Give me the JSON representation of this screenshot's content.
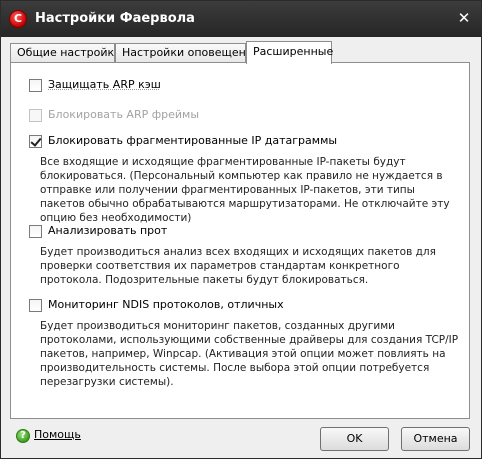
{
  "window": {
    "title": "Настройки Фаервола",
    "app_icon_letter": "C"
  },
  "tabs": [
    {
      "label": "Общие настройки"
    },
    {
      "label": "Настройки оповещений"
    },
    {
      "label": "Расширенные"
    }
  ],
  "options": [
    {
      "label": "Защищать ARP кэш",
      "checked": false,
      "enabled": true,
      "description": ""
    },
    {
      "label": "Блокировать ARP фреймы",
      "checked": false,
      "enabled": false,
      "description": ""
    },
    {
      "label": "Блокировать фрагментированные IP датаграммы",
      "checked": true,
      "enabled": true,
      "description": "Все входящие и исходящие фрагментированные IP-пакеты будут блокироваться. (Персональный компьютер как правило не нуждается в отправке или получении фрагментированных IP-пакетов, эти типы пакетов обычно обрабатываются маршрутизаторами. Не отключайте эту опцию без необходимости)"
    },
    {
      "label": "Анализировать прот",
      "checked": false,
      "enabled": true,
      "description": "Будет производиться анализ всех входящих и исходящих пакетов для проверки соответствия их параметров стандартам конкретного протокола. Подозрительные пакеты будут блокироваться."
    },
    {
      "label": "Мониторинг NDIS протоколов, отличных",
      "checked": false,
      "enabled": true,
      "description": "Будет производиться мониторинг пакетов, созданных другими протоколами, использующими собственные драйверы для создания TCP/IP пакетов, например, Winpcap. (Активация этой опции может повлиять на производительность системы. После выбора этой опции потребуется перезагрузки системы)."
    }
  ],
  "footer": {
    "help_label": "Помощь",
    "ok_label": "OK",
    "cancel_label": "Отмена"
  },
  "colors": {
    "titlebar": "#2e2e2e",
    "app_icon": "#d40000",
    "help_icon": "#3b9a1c"
  }
}
